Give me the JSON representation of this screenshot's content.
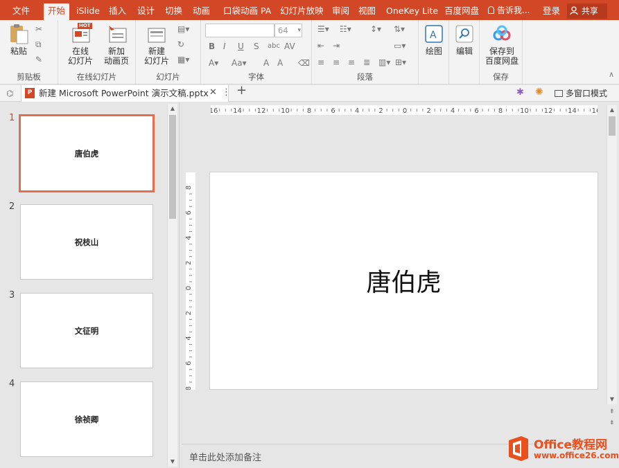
{
  "menu": {
    "tabs": [
      "文件",
      "开始",
      "iSlide",
      "插入",
      "设计",
      "切换",
      "动画",
      "口袋动画 PA",
      "幻灯片放映",
      "审阅",
      "视图",
      "OneKey Lite",
      "百度网盘"
    ],
    "active_tab": "开始",
    "tell_me": "告诉我...",
    "login": "登录",
    "share": "共享"
  },
  "ribbon": {
    "clipboard": {
      "paste": "粘贴",
      "label": "剪贴板"
    },
    "online_slides": {
      "online_btn": "在线\n幻灯片",
      "online_badge": "HOT",
      "new_anim": "新加\n动画页",
      "label": "在线幻灯片"
    },
    "slides": {
      "new_slide": "新建\n幻灯片",
      "label": "幻灯片"
    },
    "font": {
      "font_name": "",
      "font_size": "64",
      "label": "字体"
    },
    "paragraph": {
      "label": "段落"
    },
    "drawing": {
      "label": "绘图"
    },
    "editing": {
      "label": "编辑"
    },
    "save": {
      "btn": "保存到\n百度网盘",
      "label": "保存"
    }
  },
  "document": {
    "tab_name": "新建 Microsoft PowerPoint 演示文稿.pptx",
    "multi_window": "多窗口模式"
  },
  "slides": [
    {
      "num": "1",
      "title": "唐伯虎"
    },
    {
      "num": "2",
      "title": "祝枝山"
    },
    {
      "num": "3",
      "title": "文征明"
    },
    {
      "num": "4",
      "title": "徐祯卿"
    }
  ],
  "current_slide": {
    "title": "唐伯虎"
  },
  "ruler": {
    "h_labels": [
      "16",
      "14",
      "12",
      "10",
      "8",
      "6",
      "4",
      "2",
      "0",
      "2",
      "4",
      "6",
      "8",
      "10",
      "12",
      "14",
      "16"
    ],
    "v_labels": [
      "8",
      "6",
      "4",
      "2",
      "0",
      "2",
      "4",
      "6",
      "8"
    ]
  },
  "notes_placeholder": "单击此处添加备注",
  "watermark": {
    "brand": "Office教程网",
    "url": "www.office26.com"
  },
  "colors": {
    "accent": "#d24726",
    "selection": "#e26e4e"
  }
}
